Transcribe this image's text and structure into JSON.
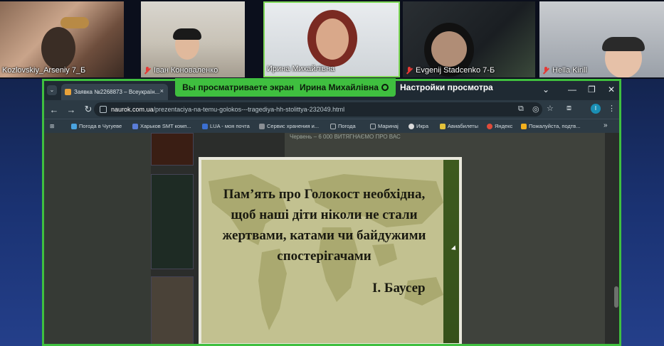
{
  "participants": [
    {
      "name": "Kozlovskiy_Arseniy 7_Б",
      "muted": false
    },
    {
      "name": "Іван Коноваленко",
      "muted": true
    },
    {
      "name": "Ирина Михайлівна",
      "muted": false
    },
    {
      "name": "Evgenij Stadcenko 7-Б",
      "muted": true
    },
    {
      "name": "Hella Kirill",
      "muted": true
    }
  ],
  "share_banner": {
    "text": "Вы просматриваете экран",
    "presenter": "Ирина Михайлівна",
    "settings": "Настройки просмотра"
  },
  "browser": {
    "tab_title": "Заявка №2268873 – Всеукраїн...",
    "tab_close": "×",
    "window_controls": [
      "⌄",
      "—",
      "❐",
      "✕"
    ],
    "url_host": "naurok.com.ua",
    "url_path": "/prezentaciya-na-temu-golokos---tragediya-hh-stolittya-232049.html",
    "bookmarks": [
      {
        "label": "Погода в Чугуеве",
        "color": "#4aa3df"
      },
      {
        "label": "Харьков SMT комп...",
        "color": "#5a7dd8"
      },
      {
        "label": "LUA - моя почта",
        "color": "#3b6fd1"
      },
      {
        "label": "Сервис хранения и...",
        "color": "#8a8f94"
      },
      {
        "label": "Погода",
        "color": "#b0b6ba"
      },
      {
        "label": "Маринаj",
        "color": "#b0b6ba"
      },
      {
        "label": "Икра",
        "color": "#d9d9d9"
      },
      {
        "label": "Авиабилеты",
        "color": "#e4c23a"
      },
      {
        "label": "Яндекс",
        "color": "#e04b3a"
      },
      {
        "label": "Пожалуйста, подтв...",
        "color": "#f2b01e"
      }
    ],
    "bookmarks_more": "»",
    "avatar_letter": "I"
  },
  "page": {
    "right_text": "Червень – 6 000 ВИТЯГНАЄМО ПРО ВАС"
  },
  "slide": {
    "quote_lines": [
      "Пам’ять про Голокост необхідна,",
      "щоб наші діти ніколи не стали",
      "жертвами, катами чи байдужими",
      "спостерігачами"
    ],
    "author": "І. Баусер"
  },
  "colors": {
    "share_border": "#3fbf3f",
    "slide_bg": "#c2c190",
    "map_land": "#aaa970"
  }
}
